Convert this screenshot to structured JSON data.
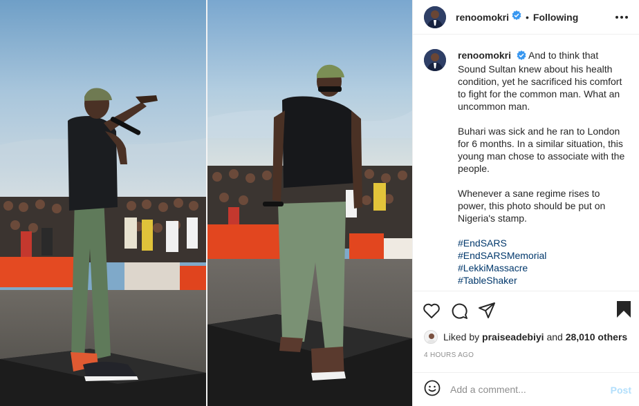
{
  "post": {
    "username": "renoomokri",
    "follow_status": "Following",
    "verified": true,
    "caption": {
      "username": "renoomokri",
      "paragraphs": [
        "And to think that Sound Sultan knew about his health condition, yet he sacrificed his comfort to fight for the common man. What an uncommon man.",
        "Buhari was sick and he ran to London for 6 months. In a similar situation, this young man chose to associate with the people.",
        "Whenever a sane regime rises to power, this photo should be put on Nigeria's stamp."
      ],
      "hashtags": [
        "#EndSARS",
        "#EndSARSMemorial",
        "#LekkiMassacre",
        "#TableShaker"
      ]
    },
    "likes": {
      "prefix": "Liked by",
      "liker": "praiseadebiyi",
      "joiner": "and",
      "others": "28,010 others"
    },
    "timestamp": "4 HOURS AGO",
    "comment": {
      "placeholder": "Add a comment...",
      "post_label": "Post"
    },
    "icons": {
      "more": "more-options-icon",
      "verified": "verified-badge-icon",
      "like": "heart-icon",
      "comment": "comment-bubble-icon",
      "share": "paper-plane-icon",
      "save": "bookmark-icon",
      "emoji": "smiley-icon"
    },
    "colors": {
      "verified_blue": "#3897f0",
      "hashtag": "#00376b",
      "post_button_disabled": "#b2dffc",
      "muted_text": "#8e8e8e"
    }
  }
}
